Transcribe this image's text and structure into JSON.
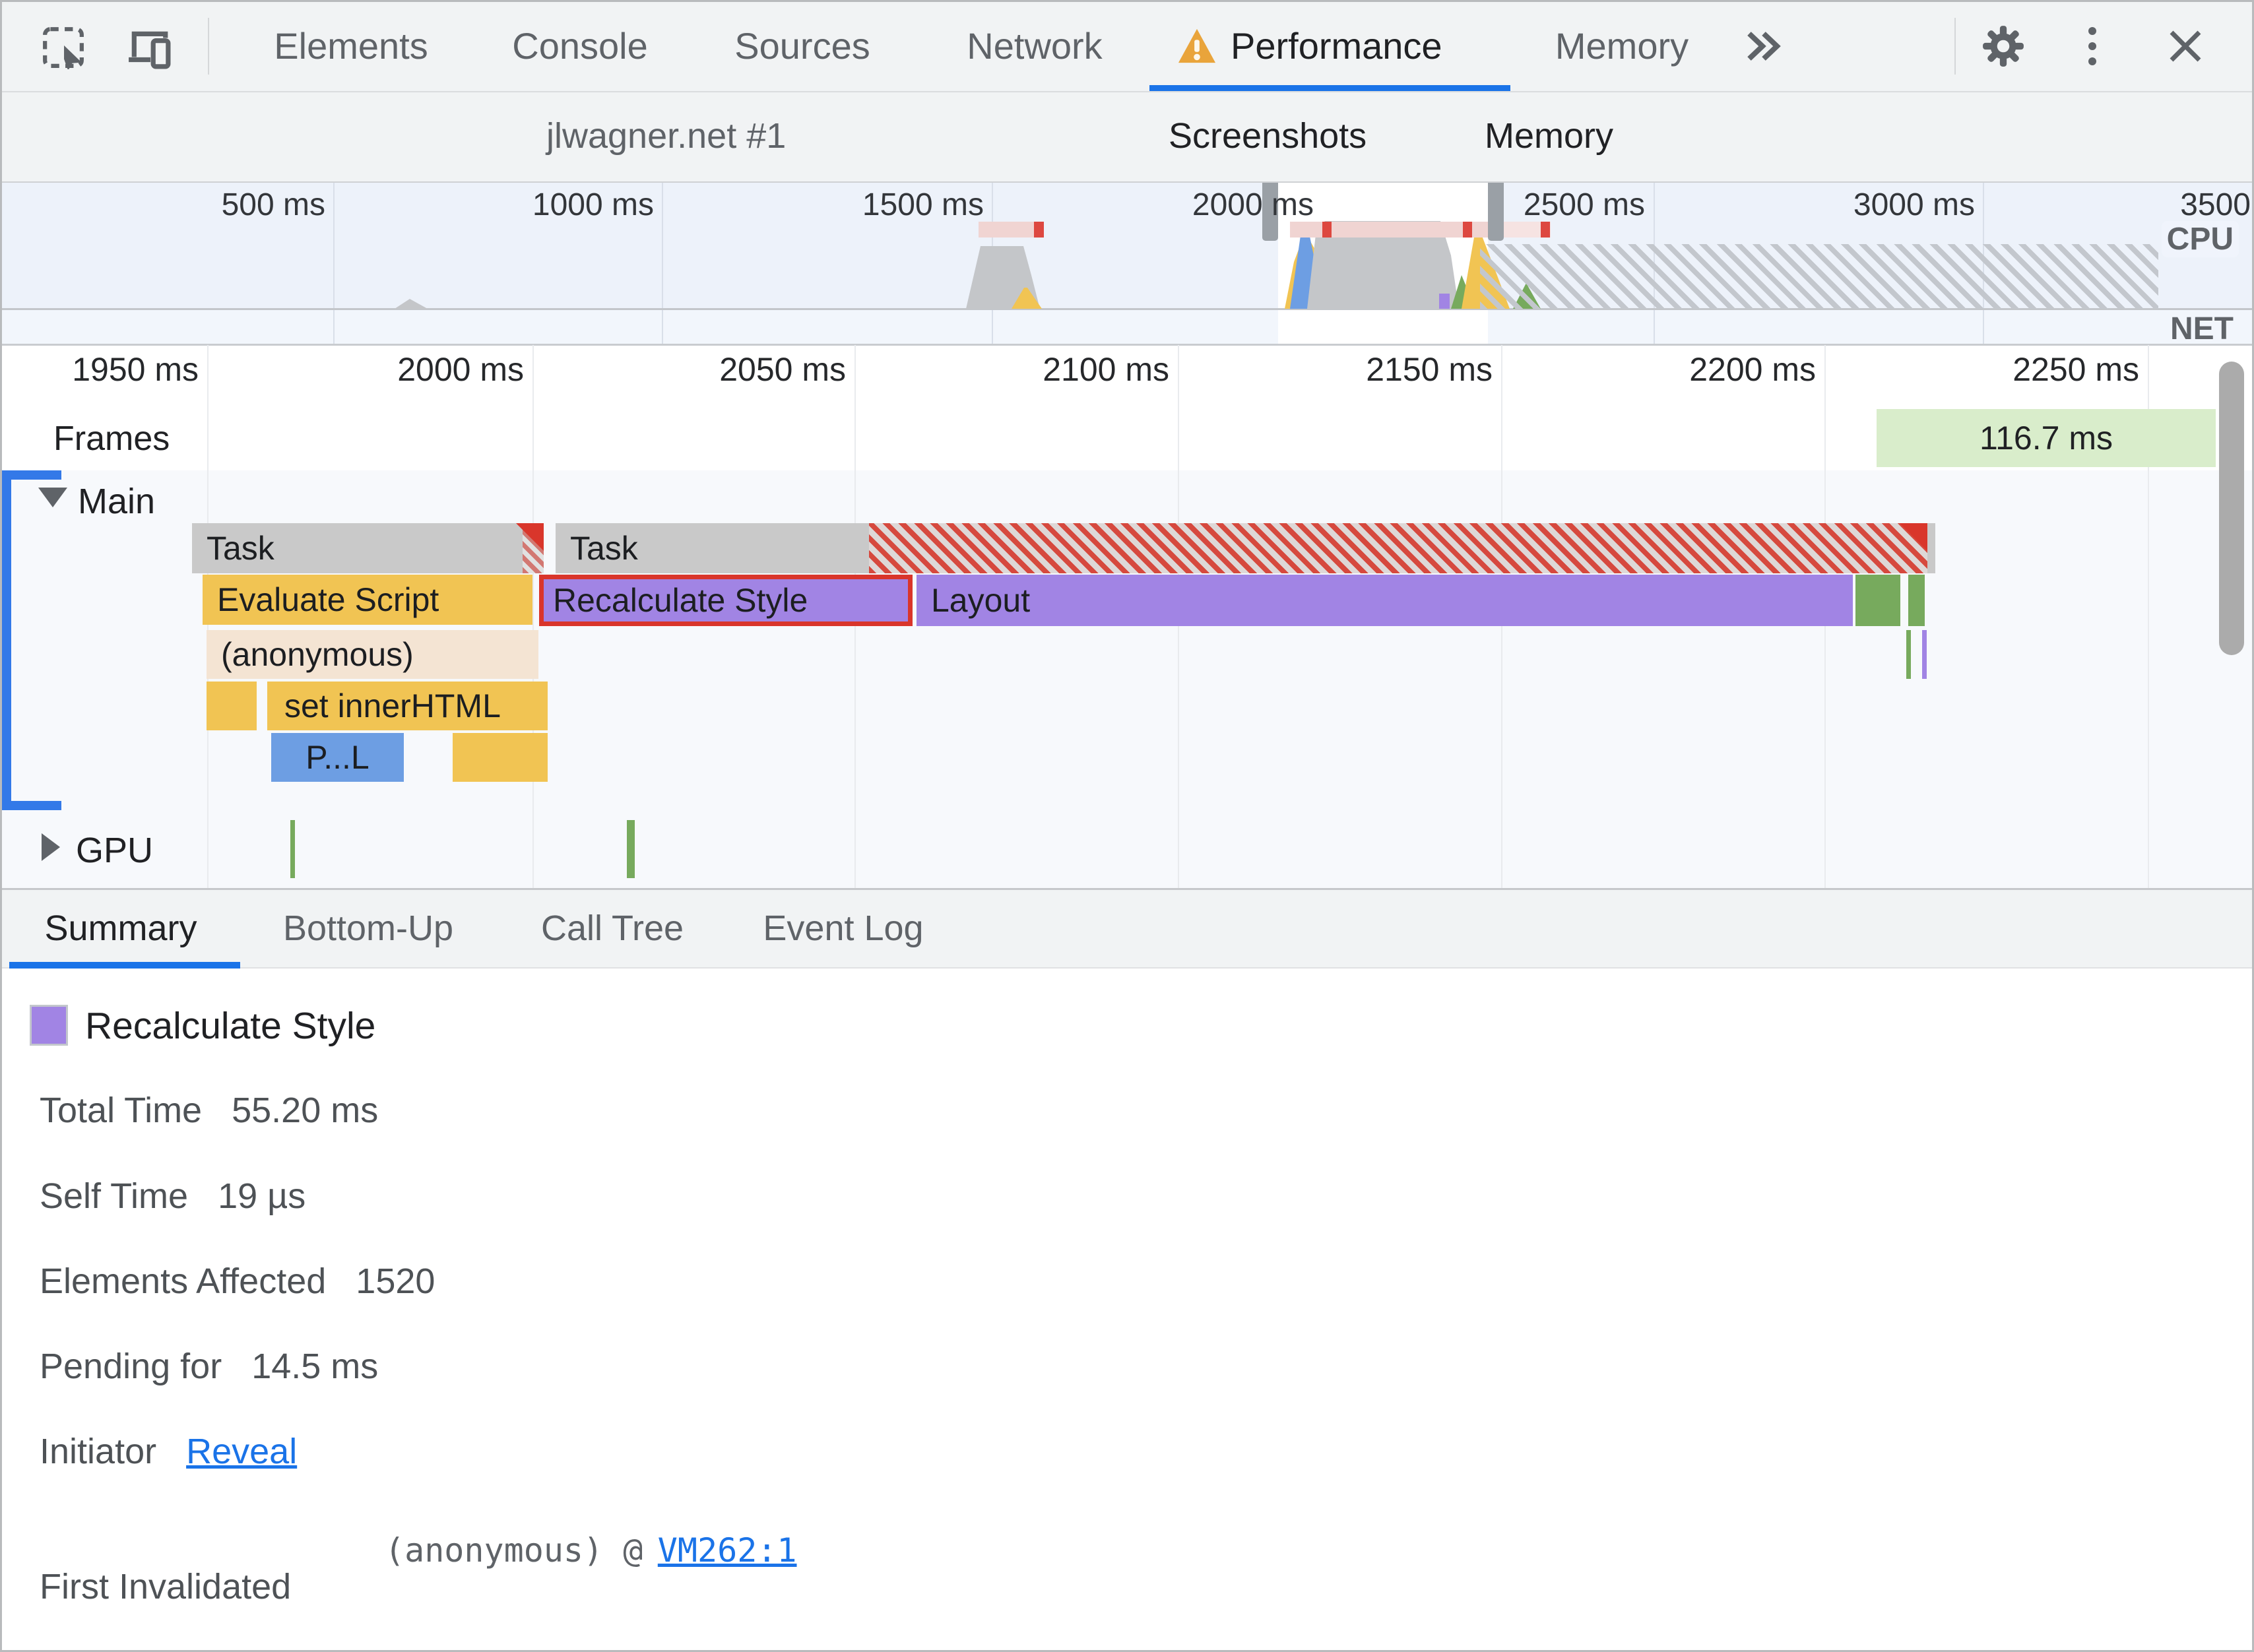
{
  "colors": {
    "accent_blue": "#1a73e8",
    "warning_orange": "#e9a43b",
    "record_settings_red": "#d93025",
    "scripting_yellow": "#f1c453",
    "rendering_purple": "#a184e4",
    "painting_green": "#77aa5d",
    "loading_blue": "#6d9ee3",
    "task_gray": "#c9c9c9",
    "long_task_red": "#d9362b",
    "frame_chip_green": "#d9edcb"
  },
  "tab_bar": {
    "tabs": [
      "Elements",
      "Console",
      "Sources",
      "Network",
      "Performance",
      "Memory"
    ],
    "active_tab": "Performance"
  },
  "toolbar": {
    "profile_select": "jlwagner.net #1",
    "screenshots_label": "Screenshots",
    "memory_label": "Memory"
  },
  "overview": {
    "tick_labels": [
      "500 ms",
      "1000 ms",
      "1500 ms",
      "2000 ms",
      "2500 ms",
      "3000 ms",
      "3500"
    ],
    "cpu_label": "CPU",
    "net_label": "NET"
  },
  "ruler": {
    "ticks": [
      "1950 ms",
      "2000 ms",
      "2050 ms",
      "2100 ms",
      "2150 ms",
      "2200 ms",
      "2250 ms"
    ]
  },
  "frames": {
    "label": "Frames",
    "duration": "116.7 ms"
  },
  "main": {
    "label": "Main",
    "bars": {
      "task1": "Task",
      "task2": "Task",
      "evaluate_script": "Evaluate Script",
      "recalculate_style": "Recalculate Style",
      "layout": "Layout",
      "anonymous": "(anonymous)",
      "set_inner_html": "set innerHTML",
      "parse_html": "P...L"
    }
  },
  "gpu": {
    "label": "GPU"
  },
  "bottom_tabs": [
    "Summary",
    "Bottom-Up",
    "Call Tree",
    "Event Log"
  ],
  "summary": {
    "title": "Recalculate Style",
    "rows": [
      {
        "label": "Total Time",
        "value": "55.20 ms"
      },
      {
        "label": "Self Time",
        "value": "19 µs"
      },
      {
        "label": "Elements Affected",
        "value": "1520"
      },
      {
        "label": "Pending for",
        "value": "14.5 ms"
      }
    ],
    "initiator": {
      "label": "Initiator",
      "link": "Reveal"
    },
    "first_invalidated": {
      "label": "First Invalidated",
      "trace": "(anonymous) @",
      "link": "VM262:1"
    }
  }
}
